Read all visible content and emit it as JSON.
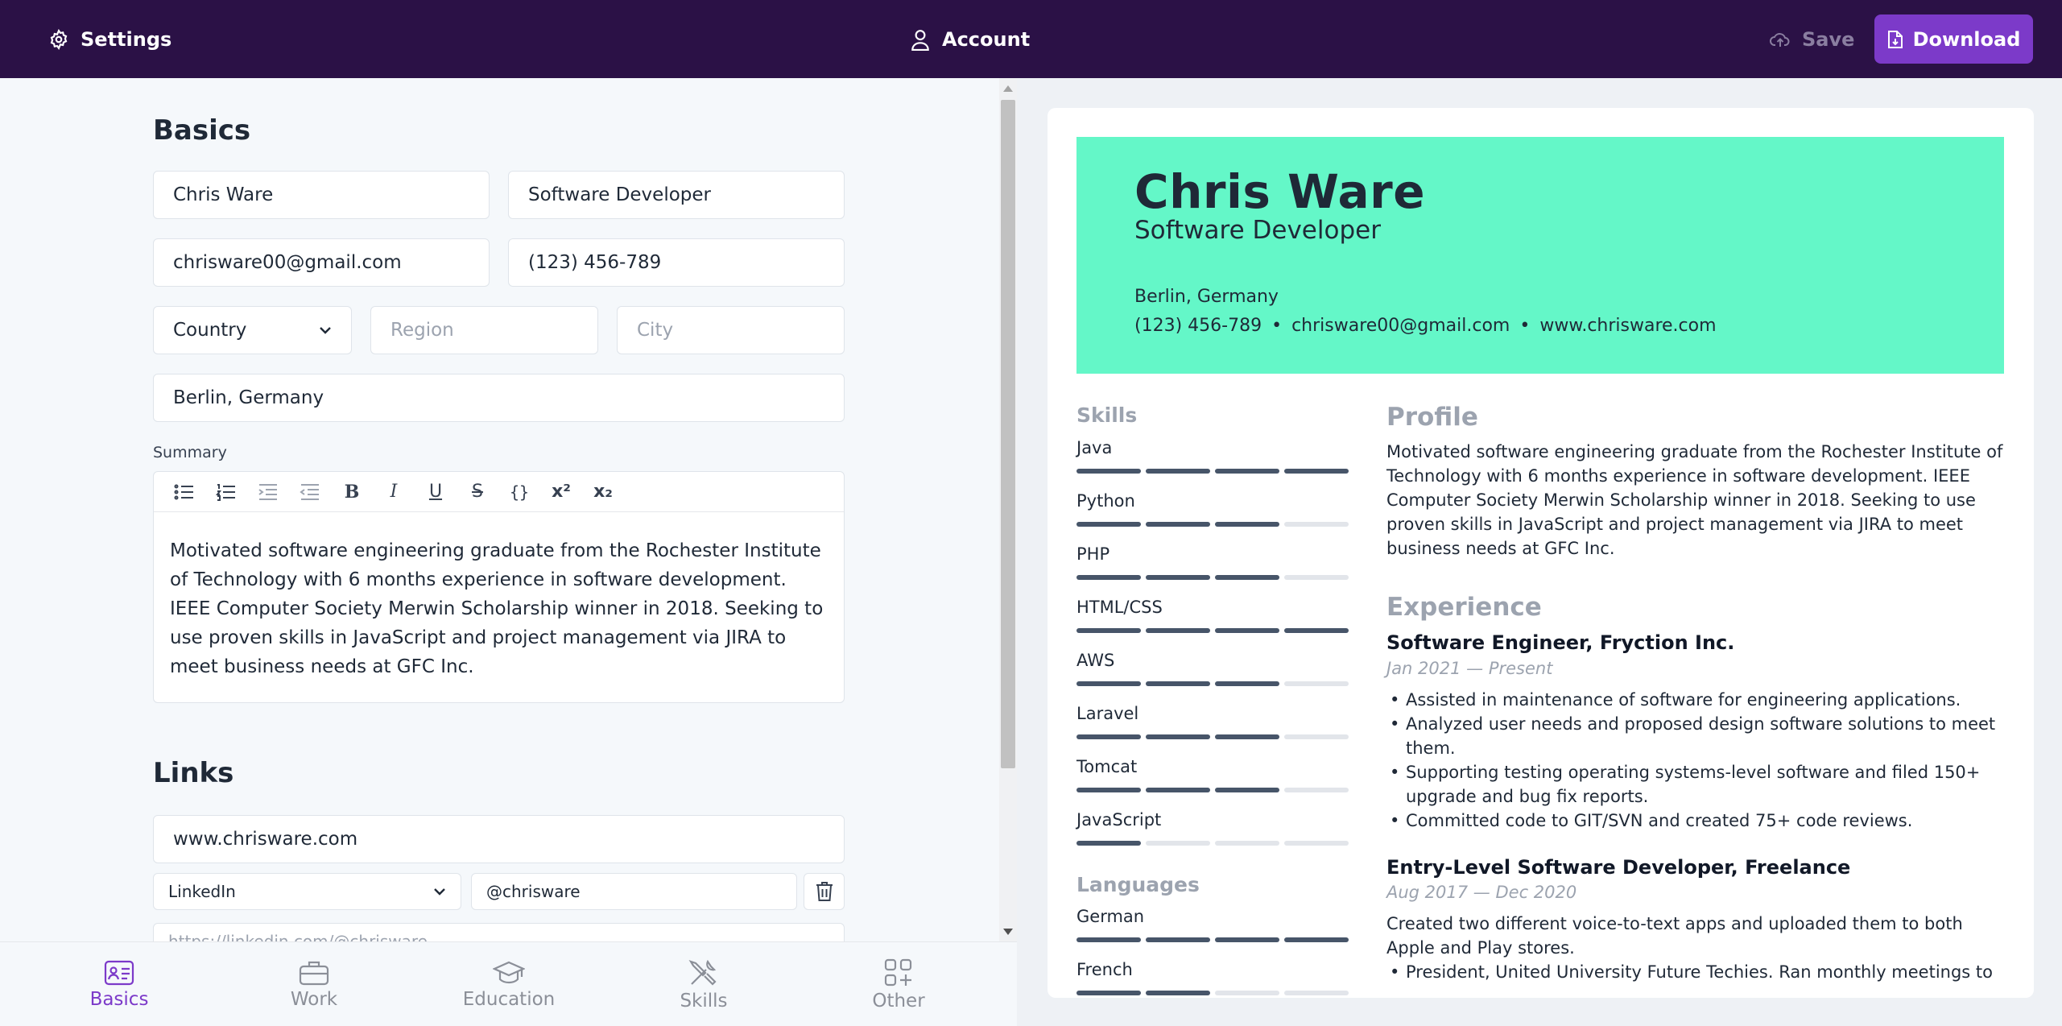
{
  "topbar": {
    "settings_label": "Settings",
    "account_label": "Account",
    "save_label": "Save",
    "download_label": "Download"
  },
  "basics": {
    "section_title": "Basics",
    "name": "Chris Ware",
    "title": "Software Developer",
    "email": "chrisware00@gmail.com",
    "phone": "(123) 456-789",
    "country_select": "Country",
    "region_placeholder": "Region",
    "city_placeholder": "City",
    "location": "Berlin, Germany",
    "summary_label": "Summary",
    "summary": "Motivated software engineering graduate from the Rochester Institute of Technology with 6 months experience in software development. IEEE Computer Society Merwin Scholarship winner in 2018. Seeking to use proven skills in JavaScript and project management via JIRA to meet business needs at GFC Inc."
  },
  "links": {
    "section_title": "Links",
    "website": "www.chrisware.com",
    "profiles": [
      {
        "network": "LinkedIn",
        "username": "@chrisware",
        "url": "https://linkedin.com/@chrisware"
      }
    ]
  },
  "bottom_nav": {
    "tabs": [
      {
        "label": "Basics",
        "icon": "id-card-icon",
        "active": true
      },
      {
        "label": "Work",
        "icon": "briefcase-icon",
        "active": false
      },
      {
        "label": "Education",
        "icon": "graduation-cap-icon",
        "active": false
      },
      {
        "label": "Skills",
        "icon": "tools-icon",
        "active": false
      },
      {
        "label": "Other",
        "icon": "grid-plus-icon",
        "active": false
      }
    ]
  },
  "preview": {
    "name": "Chris Ware",
    "role": "Software Developer",
    "location": "Berlin, Germany",
    "phone": "(123) 456-789",
    "email": "chrisware00@gmail.com",
    "website": "www.chrisware.com",
    "separator": "•",
    "skills_title": "Skills",
    "skills": [
      {
        "name": "Java",
        "level": 4
      },
      {
        "name": "Python",
        "level": 3
      },
      {
        "name": "PHP",
        "level": 3
      },
      {
        "name": "HTML/CSS",
        "level": 4
      },
      {
        "name": "AWS",
        "level": 3
      },
      {
        "name": "Laravel",
        "level": 3
      },
      {
        "name": "Tomcat",
        "level": 3
      },
      {
        "name": "JavaScript",
        "level": 1
      }
    ],
    "languages_title": "Languages",
    "languages": [
      {
        "name": "German",
        "level": 4
      },
      {
        "name": "French",
        "level": 2
      }
    ],
    "level_max": 4,
    "profile_title": "Profile",
    "profile_text": "Motivated software engineering graduate from the Rochester Institute of Technology with 6 months experience in software development. IEEE Computer Society Merwin Scholarship winner in 2018. Seeking to use proven skills in JavaScript and project management via JIRA to meet business needs at GFC Inc.",
    "experience_title": "Experience",
    "jobs": [
      {
        "title": "Software Engineer, Fryction Inc.",
        "date": "Jan 2021 — Present",
        "bullets": [
          "Assisted in maintenance of software for engineering applications.",
          "Analyzed user needs and proposed design software solutions to meet them.",
          "Supporting testing operating systems-level software and filed 150+ upgrade and bug fix reports.",
          "Committed code to GIT/SVN and created 75+ code reviews."
        ]
      },
      {
        "title": "Entry-Level Software Developer, Freelance",
        "date": "Aug 2017 — Dec 2020",
        "summary": "Created two different voice-to-text apps and uploaded them to both Apple and Play stores.",
        "bullets": [
          "President, United University Future Techies. Ran monthly meetings to"
        ]
      }
    ]
  },
  "colors": {
    "topbar": "#2b1146",
    "accent": "#7c3ac9",
    "resume_header": "#64f7c8"
  }
}
